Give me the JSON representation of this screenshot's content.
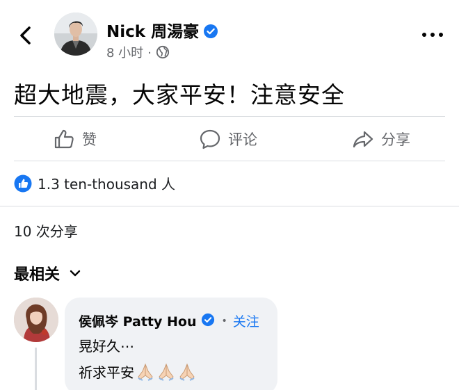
{
  "post": {
    "author": "Nick 周湯豪",
    "time": "8 小时",
    "separator": "·",
    "text": "超大地震，大家平安！注意安全"
  },
  "actions": {
    "like": "赞",
    "comment": "评论",
    "share": "分享"
  },
  "reactions": {
    "count": "1.3 ten-thousand 人"
  },
  "shares": {
    "text": "10 次分享"
  },
  "comments": {
    "sort_label": "最相关",
    "items": [
      {
        "author": "侯佩岑 Patty Hou",
        "separator": "•",
        "follow": "关注",
        "line1": "晃好久⋯",
        "line2": "祈求平安"
      }
    ]
  },
  "colors": {
    "accent": "#1877f2",
    "secondary_text": "#65676b",
    "bubble": "#f0f2f5",
    "divider": "#dadde1"
  },
  "icons": {
    "back": "back-arrow-icon",
    "verified": "verified-badge-icon",
    "audience": "globe-icon",
    "more": "more-horizontal-icon",
    "like": "thumbs-up-icon",
    "comment": "comment-bubble-icon",
    "share": "share-arrow-icon",
    "reaction": "like-reaction-icon",
    "sort": "chevron-down-icon",
    "emoji": "folded-hands-emoji"
  }
}
